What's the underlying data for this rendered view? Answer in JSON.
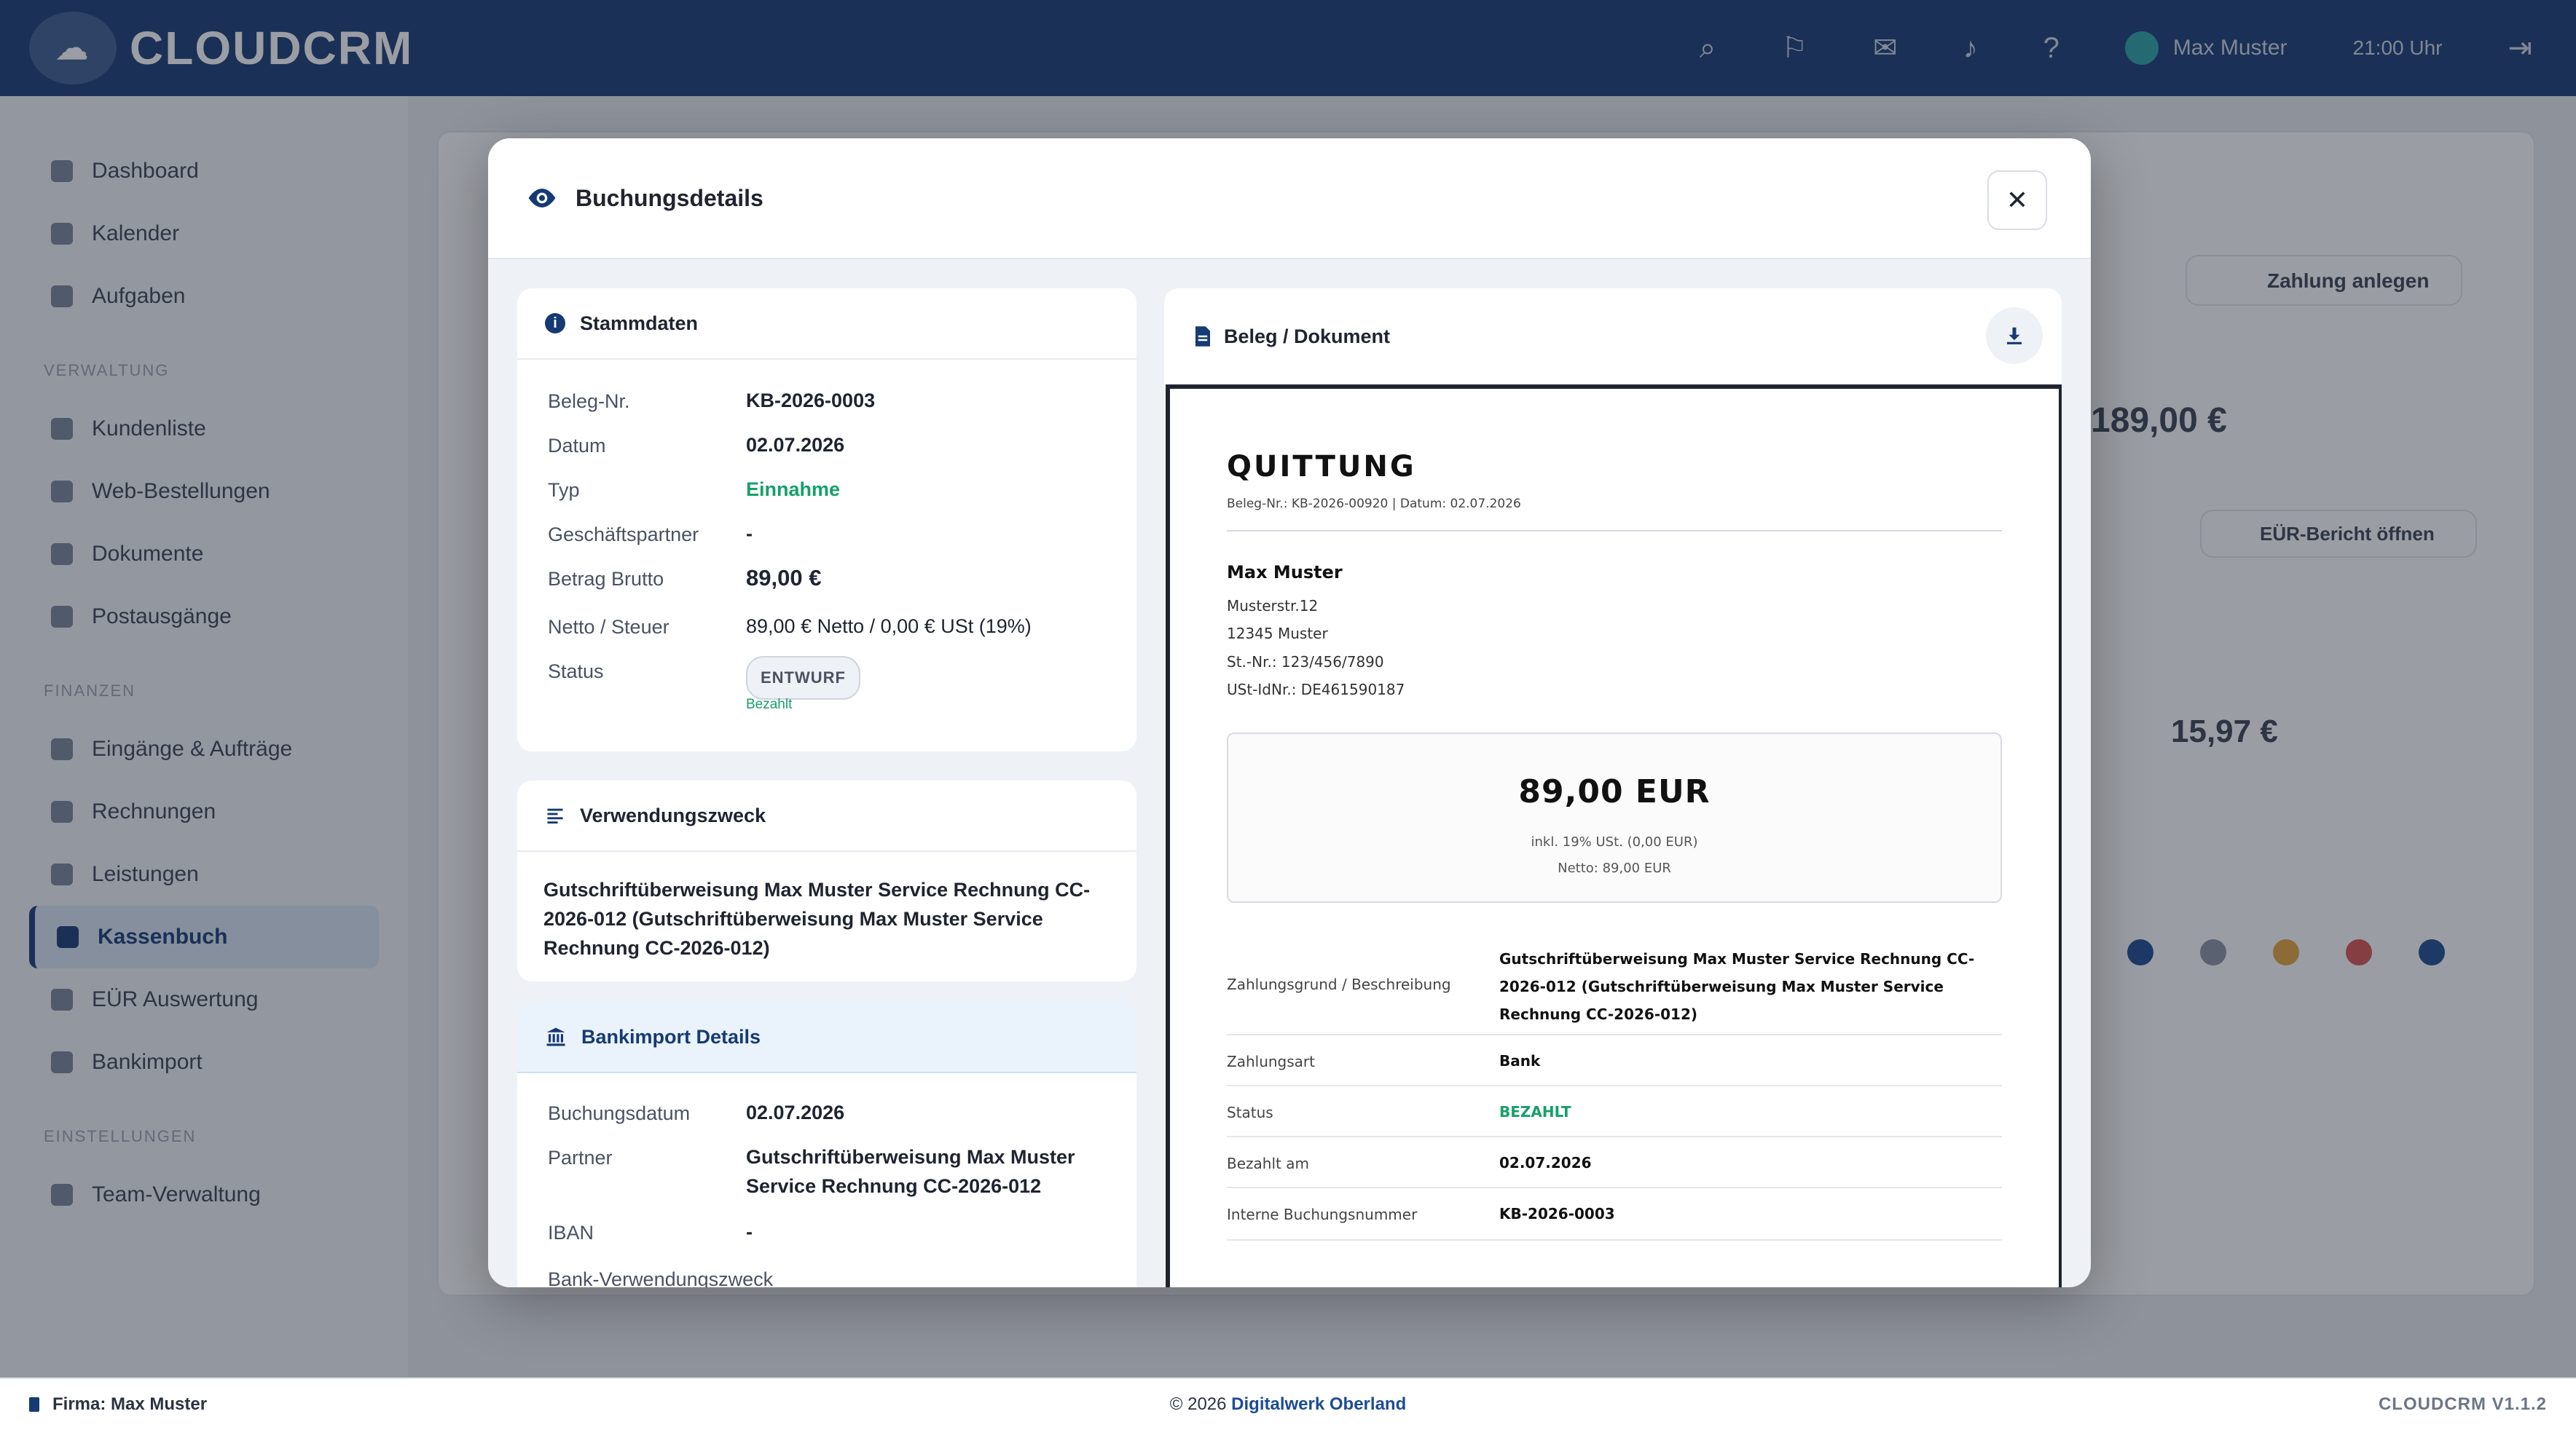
{
  "app": {
    "brand": "CLOUDCRM",
    "top_user": "Max Muster",
    "top_time": "21:00 Uhr",
    "sidebar_items": [
      "Dashboard",
      "Kalender",
      "Aufgaben",
      "Kundenliste",
      "Web-Bestellungen",
      "Dokumente",
      "Postausgänge",
      "Eingänge & Aufträge",
      "Rechnungen",
      "Leistungen",
      "Kassenbuch",
      "EÜR Auswertung",
      "Bankimport",
      "Team-Verwaltung"
    ],
    "sidebar_groups": [
      "Verwaltung",
      "Finanzen",
      "Einstellungen"
    ],
    "bg_button": "Zahlung anlegen",
    "bg_total": "189,00 €",
    "bg_badge": "EÜR-Bericht öffnen",
    "bg_amount2": "15,97 €"
  },
  "footer": {
    "firm": "Firma: Max Muster",
    "copyright": "© 2026",
    "company": "Digitalwerk Oberland",
    "version": "CLOUDCRM V1.1.2"
  },
  "modal": {
    "title": "Buchungsdetails",
    "close_label": "✕",
    "stammdaten": {
      "title": "Stammdaten",
      "rows": [
        {
          "k": "Beleg-Nr.",
          "v": "KB-2026-0003"
        },
        {
          "k": "Datum",
          "v": "02.07.2026"
        },
        {
          "k": "Typ",
          "v": "Einnahme"
        },
        {
          "k": "Geschäftspartner",
          "v": "-"
        },
        {
          "k": "Betrag Brutto",
          "v": "89,00 €"
        },
        {
          "k": "Netto / Steuer",
          "v": "89,00 € Netto / 0,00 € USt (19%)"
        },
        {
          "k": "Status",
          "v": "ENTWURF"
        }
      ],
      "status_sub": "Bezahlt"
    },
    "verwendungszweck": {
      "title": "Verwendungszweck",
      "text": "Gutschriftüberweisung Max Muster Service Rechnung CC-2026-012 (Gutschriftüberweisung Max Muster Service Rechnung CC-2026-012)"
    },
    "bankimport": {
      "title": "Bankimport Details",
      "rows": [
        {
          "k": "Buchungsdatum",
          "v": "02.07.2026"
        },
        {
          "k": "Partner",
          "v": "Gutschriftüberweisung Max Muster Service Rechnung CC-2026-012"
        },
        {
          "k": "IBAN",
          "v": "-"
        },
        {
          "k": "Bank-Verwendungszweck",
          "v": ""
        }
      ]
    },
    "beleg": {
      "title": "Beleg / Dokument",
      "doc_title": "QUITTUNG",
      "doc_meta": "Beleg-Nr.: KB-2026-00920 | Datum: 02.07.2026",
      "addr_name": "Max Muster",
      "addr_lines": [
        "Musterstr.12",
        "12345 Muster",
        "St.-Nr.: 123/456/7890",
        "USt-IdNr.: DE461590187"
      ],
      "amount": "89,00 EUR",
      "amount_tax": "inkl. 19% USt. (0,00 EUR)",
      "amount_net": "Netto: 89,00 EUR",
      "details": [
        {
          "k": "Zahlungsgrund / Beschreibung",
          "v": "Gutschriftüberweisung Max Muster Service Rechnung CC-2026-012 (Gutschriftüberweisung Max Muster Service Rechnung CC-2026-012)"
        },
        {
          "k": "Zahlungsart",
          "v": "Bank"
        },
        {
          "k": "Status",
          "v": "BEZAHLT"
        },
        {
          "k": "Bezahlt am",
          "v": "02.07.2026"
        },
        {
          "k": "Interne Buchungsnummer",
          "v": "KB-2026-0003"
        }
      ]
    }
  },
  "colors": {
    "brand": "#163a73",
    "success": "#16a06a"
  }
}
